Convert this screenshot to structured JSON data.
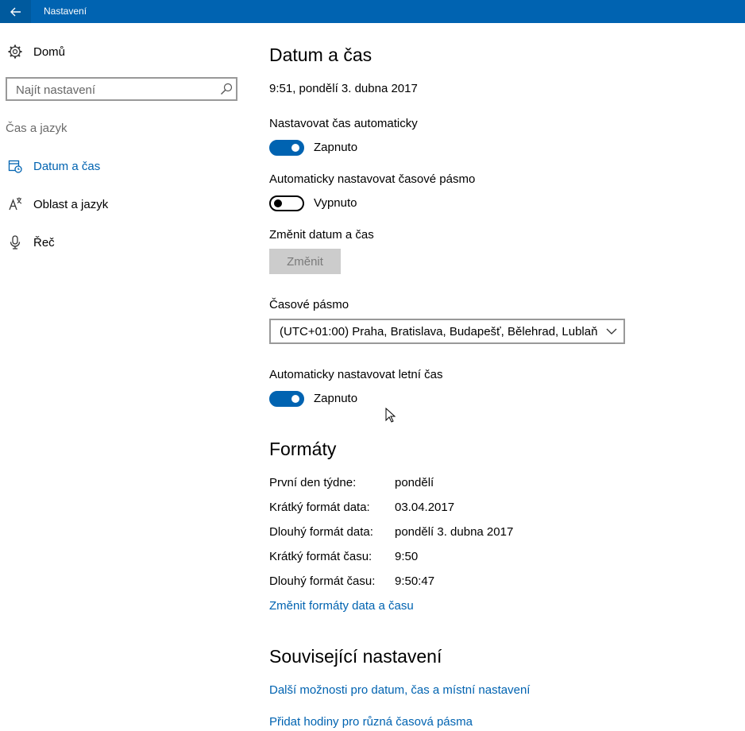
{
  "window": {
    "title": "Nastavení"
  },
  "sidebar": {
    "home_label": "Domů",
    "search_placeholder": "Najít nastavení",
    "group_label": "Čas a jazyk",
    "items": [
      {
        "label": "Datum a čas",
        "icon": "calendar-clock-icon",
        "selected": true
      },
      {
        "label": "Oblast a jazyk",
        "icon": "language-icon",
        "selected": false
      },
      {
        "label": "Řeč",
        "icon": "microphone-icon",
        "selected": false
      }
    ]
  },
  "main": {
    "title": "Datum a čas",
    "current_datetime": "9:51, pondělí 3. dubna 2017",
    "auto_time": {
      "label": "Nastavovat čas automaticky",
      "state": "Zapnuto",
      "on": true
    },
    "auto_timezone": {
      "label": "Automaticky nastavovat časové pásmo",
      "state": "Vypnuto",
      "on": false
    },
    "change_datetime": {
      "label": "Změnit datum a čas",
      "button": "Změnit"
    },
    "timezone": {
      "label": "Časové pásmo",
      "value": "(UTC+01:00) Praha, Bratislava, Budapešť, Bělehrad, Lublaň"
    },
    "auto_dst": {
      "label": "Automaticky nastavovat letní čas",
      "state": "Zapnuto",
      "on": true
    }
  },
  "formats": {
    "title": "Formáty",
    "rows": [
      {
        "label": "První den týdne:",
        "value": "pondělí"
      },
      {
        "label": "Krátký formát data:",
        "value": "03.04.2017"
      },
      {
        "label": "Dlouhý formát data:",
        "value": "pondělí 3. dubna 2017"
      },
      {
        "label": "Krátký formát času:",
        "value": "9:50"
      },
      {
        "label": "Dlouhý formát času:",
        "value": "9:50:47"
      }
    ],
    "change_link": "Změnit formáty data a času"
  },
  "related": {
    "title": "Související nastavení",
    "links": [
      "Další možnosti pro datum, čas a místní nastavení",
      "Přidat hodiny pro různá časová pásma"
    ]
  },
  "colors": {
    "accent": "#0063b1",
    "titlebar": "#0063b1",
    "disabled_button": "#cccccc"
  }
}
